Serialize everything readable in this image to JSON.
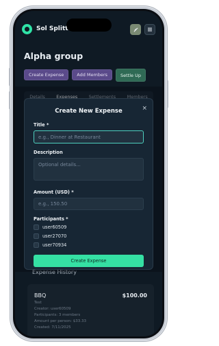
{
  "app": {
    "brand": "Sol Splitter",
    "page_title": "Alpha group"
  },
  "actions": {
    "create_expense": "Create Expense",
    "add_members": "Add Members",
    "settle_up": "Settle Up"
  },
  "tabs": [
    {
      "label": "Details"
    },
    {
      "label": "Expenses"
    },
    {
      "label": "Settlements"
    },
    {
      "label": "Members"
    }
  ],
  "modal": {
    "title": "Create New Expense",
    "close": "×",
    "title_label": "Title *",
    "title_placeholder": "e.g., Dinner at Restaurant",
    "description_label": "Description",
    "description_placeholder": "Optional details...",
    "amount_label": "Amount (USD) *",
    "amount_placeholder": "e.g., 150.50",
    "participants_label": "Participants *",
    "participants": [
      {
        "name": "user60509"
      },
      {
        "name": "user27070"
      },
      {
        "name": "user70934"
      }
    ],
    "submit": "Create Expense"
  },
  "history": {
    "title": "Expense History",
    "items": [
      {
        "name": "BBQ",
        "amount": "$100.00",
        "lines": [
          "Test",
          "Creator: user60509",
          "Participants: 3 members",
          "Amount per person: $33.33",
          "Created: 7/11/2025"
        ]
      }
    ]
  },
  "icons": {
    "palette": "palette-icon",
    "menu": "menu-icon",
    "close": "close-icon"
  },
  "colors": {
    "accent": "#35e0a4",
    "purple_button": "#5a4a8a",
    "background": "#0f1a24"
  }
}
